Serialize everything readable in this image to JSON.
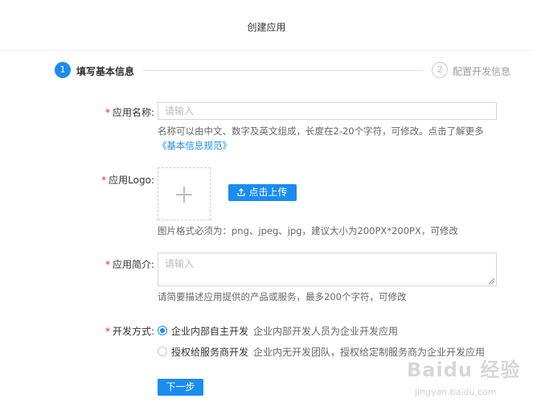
{
  "header": {
    "title": "创建应用"
  },
  "steps": [
    {
      "num": "1",
      "label": "填写基本信息"
    },
    {
      "num": "2",
      "label": "配置开发信息"
    }
  ],
  "form": {
    "app_name": {
      "label": "应用名称:",
      "placeholder": "请输入",
      "hint": "名称可以由中文、数字及英文组成，长度在2-20个字符，可修改。点击了解更多",
      "link": "《基本信息规范》"
    },
    "app_logo": {
      "label": "应用Logo:",
      "upload_button": "点击上传",
      "hint": "图片格式必须为：png、jpeg、jpg，建议大小为200PX*200PX，可修改"
    },
    "app_intro": {
      "label": "应用简介:",
      "placeholder": "请输入",
      "hint": "请简要描述应用提供的产品或服务，最多200个字符，可修改"
    },
    "dev_mode": {
      "label": "开发方式:",
      "options": [
        {
          "title": "企业内部自主开发",
          "desc": "企业内部开发人员为企业开发应用",
          "selected": true
        },
        {
          "title": "授权给服务商开发",
          "desc": "企业内无开发团队，授权给定制服务商为企业开发应用",
          "selected": false
        }
      ]
    },
    "next_button": "下一步"
  },
  "watermark": {
    "logo": "Baidu 经验",
    "sub": "jingyan.baidu.com"
  },
  "colors": {
    "accent": "#1a8cf0",
    "required": "#e5262b"
  }
}
